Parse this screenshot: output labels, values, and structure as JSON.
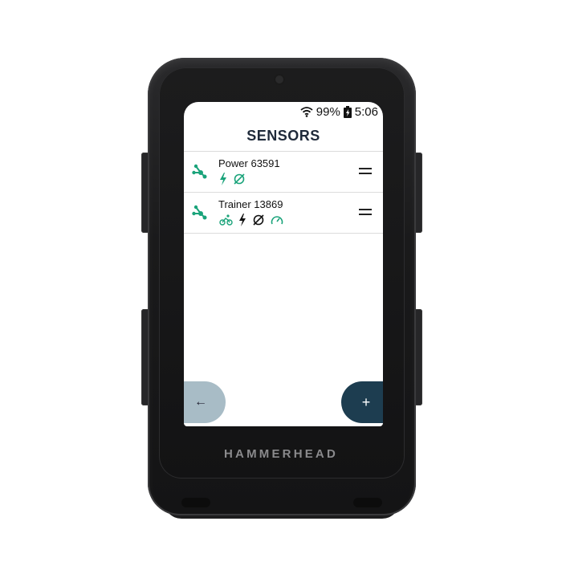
{
  "status_bar": {
    "battery": "99%",
    "time": "5:06"
  },
  "title": "SENSORS",
  "sensors": [
    {
      "name": "Power 63591",
      "capabilities": [
        "power-icon",
        "cadence-icon"
      ]
    },
    {
      "name": "Trainer 13869",
      "capabilities": [
        "cyclist-icon",
        "power-icon",
        "cadence-icon",
        "speed-icon"
      ]
    }
  ],
  "buttons": {
    "back": "←",
    "add": "+"
  },
  "brand": "HAMMERHEAD",
  "colors": {
    "accent": "#1aa37a",
    "add_button": "#1d3d50",
    "back_button": "#a8bcc6"
  }
}
